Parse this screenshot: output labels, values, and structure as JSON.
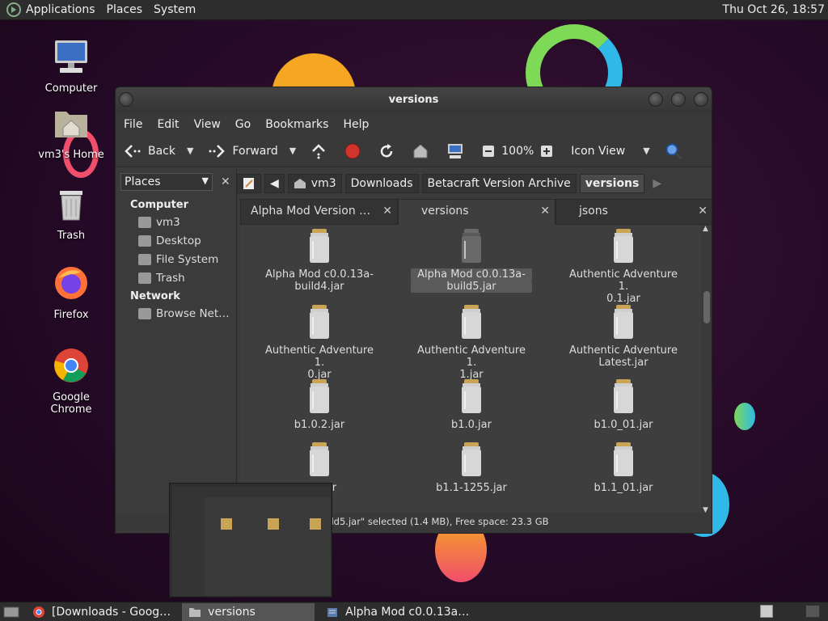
{
  "top_panel": {
    "menus": [
      "Applications",
      "Places",
      "System"
    ],
    "clock": "Thu Oct 26, 18:57"
  },
  "desktop": {
    "icons": [
      {
        "label": "Computer",
        "icon": "computer-icon"
      },
      {
        "label": "vm3's Home",
        "icon": "home-folder-icon"
      },
      {
        "label": "Trash",
        "icon": "trash-icon"
      },
      {
        "label": "Firefox",
        "icon": "firefox-icon"
      },
      {
        "label": "Google Chrome",
        "icon": "chrome-icon"
      }
    ]
  },
  "window": {
    "title": "versions",
    "menubar": [
      "File",
      "Edit",
      "View",
      "Go",
      "Bookmarks",
      "Help"
    ],
    "toolbar": {
      "back": "Back",
      "forward": "Forward",
      "zoom": "100%",
      "view_mode": "Icon View"
    },
    "sidebar": {
      "selector": "Places",
      "sections": [
        {
          "heading": "Computer",
          "items": [
            "vm3",
            "Desktop",
            "File System",
            "Trash"
          ]
        },
        {
          "heading": "Network",
          "items": [
            "Browse Net…"
          ]
        }
      ]
    },
    "pathbar": [
      "vm3",
      "Downloads",
      "Betacraft Version Archive",
      "versions"
    ],
    "tabs": [
      {
        "label": "Alpha Mod Version …"
      },
      {
        "label": "versions"
      },
      {
        "label": "jsons"
      }
    ],
    "files": [
      {
        "line1": "Alpha Mod c0.0.13a-",
        "line2": "build4.jar"
      },
      {
        "line1": "Alpha Mod c0.0.13a-",
        "line2": "build5.jar"
      },
      {
        "line1": "Authentic Adventure 1.",
        "line2": "0.1.jar"
      },
      {
        "line1": "Authentic Adventure 1.",
        "line2": "0.jar"
      },
      {
        "line1": "Authentic Adventure 1.",
        "line2": "1.jar"
      },
      {
        "line1": "Authentic Adventure",
        "line2": "Latest.jar"
      },
      {
        "line1": "b1.0.2.jar",
        "line2": ""
      },
      {
        "line1": "b1.0.jar",
        "line2": ""
      },
      {
        "line1": "b1.0_01.jar",
        "line2": ""
      },
      {
        "line1": "…5.jar",
        "line2": ""
      },
      {
        "line1": "b1.1-1255.jar",
        "line2": ""
      },
      {
        "line1": "b1.1_01.jar",
        "line2": ""
      }
    ],
    "status": "…a-build5.jar\" selected (1.4 MB), Free space: 23.3 GB"
  },
  "taskbar": {
    "tasks": [
      {
        "label": "[Downloads - Goog…",
        "icon": "chrome-icon"
      },
      {
        "label": "versions",
        "icon": "folder-icon"
      },
      {
        "label": "Alpha Mod c0.0.13a…",
        "icon": "java-icon"
      }
    ]
  },
  "colors": {
    "panel": "#2d2d2d",
    "window_bg": "#3b3b3b",
    "stop_red": "#d0342c",
    "search_blue": "#3a7bd5"
  }
}
